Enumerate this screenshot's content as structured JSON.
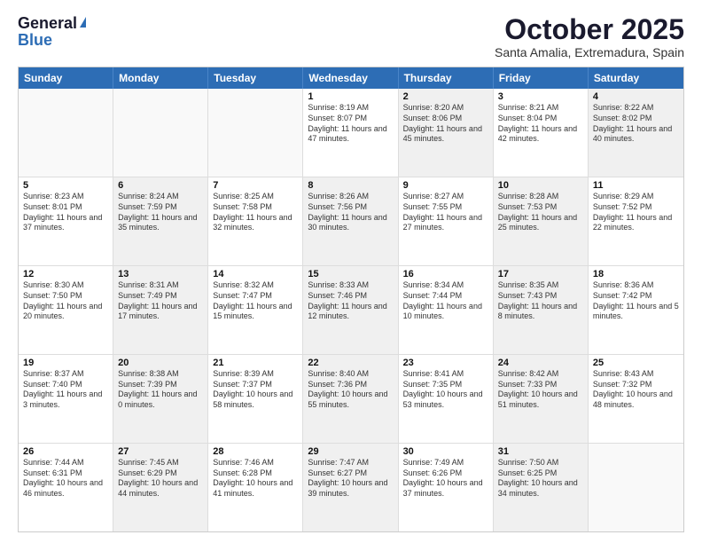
{
  "header": {
    "logo_general": "General",
    "logo_blue": "Blue",
    "month_title": "October 2025",
    "subtitle": "Santa Amalia, Extremadura, Spain"
  },
  "days_of_week": [
    "Sunday",
    "Monday",
    "Tuesday",
    "Wednesday",
    "Thursday",
    "Friday",
    "Saturday"
  ],
  "weeks": [
    {
      "cells": [
        {
          "day": "",
          "empty": true,
          "shaded": false
        },
        {
          "day": "",
          "empty": true,
          "shaded": false
        },
        {
          "day": "",
          "empty": true,
          "shaded": false
        },
        {
          "day": "1",
          "empty": false,
          "shaded": false,
          "text": "Sunrise: 8:19 AM\nSunset: 8:07 PM\nDaylight: 11 hours\nand 47 minutes."
        },
        {
          "day": "2",
          "empty": false,
          "shaded": true,
          "text": "Sunrise: 8:20 AM\nSunset: 8:06 PM\nDaylight: 11 hours\nand 45 minutes."
        },
        {
          "day": "3",
          "empty": false,
          "shaded": false,
          "text": "Sunrise: 8:21 AM\nSunset: 8:04 PM\nDaylight: 11 hours\nand 42 minutes."
        },
        {
          "day": "4",
          "empty": false,
          "shaded": true,
          "text": "Sunrise: 8:22 AM\nSunset: 8:02 PM\nDaylight: 11 hours\nand 40 minutes."
        }
      ]
    },
    {
      "cells": [
        {
          "day": "5",
          "empty": false,
          "shaded": false,
          "text": "Sunrise: 8:23 AM\nSunset: 8:01 PM\nDaylight: 11 hours\nand 37 minutes."
        },
        {
          "day": "6",
          "empty": false,
          "shaded": true,
          "text": "Sunrise: 8:24 AM\nSunset: 7:59 PM\nDaylight: 11 hours\nand 35 minutes."
        },
        {
          "day": "7",
          "empty": false,
          "shaded": false,
          "text": "Sunrise: 8:25 AM\nSunset: 7:58 PM\nDaylight: 11 hours\nand 32 minutes."
        },
        {
          "day": "8",
          "empty": false,
          "shaded": true,
          "text": "Sunrise: 8:26 AM\nSunset: 7:56 PM\nDaylight: 11 hours\nand 30 minutes."
        },
        {
          "day": "9",
          "empty": false,
          "shaded": false,
          "text": "Sunrise: 8:27 AM\nSunset: 7:55 PM\nDaylight: 11 hours\nand 27 minutes."
        },
        {
          "day": "10",
          "empty": false,
          "shaded": true,
          "text": "Sunrise: 8:28 AM\nSunset: 7:53 PM\nDaylight: 11 hours\nand 25 minutes."
        },
        {
          "day": "11",
          "empty": false,
          "shaded": false,
          "text": "Sunrise: 8:29 AM\nSunset: 7:52 PM\nDaylight: 11 hours\nand 22 minutes."
        }
      ]
    },
    {
      "cells": [
        {
          "day": "12",
          "empty": false,
          "shaded": false,
          "text": "Sunrise: 8:30 AM\nSunset: 7:50 PM\nDaylight: 11 hours\nand 20 minutes."
        },
        {
          "day": "13",
          "empty": false,
          "shaded": true,
          "text": "Sunrise: 8:31 AM\nSunset: 7:49 PM\nDaylight: 11 hours\nand 17 minutes."
        },
        {
          "day": "14",
          "empty": false,
          "shaded": false,
          "text": "Sunrise: 8:32 AM\nSunset: 7:47 PM\nDaylight: 11 hours\nand 15 minutes."
        },
        {
          "day": "15",
          "empty": false,
          "shaded": true,
          "text": "Sunrise: 8:33 AM\nSunset: 7:46 PM\nDaylight: 11 hours\nand 12 minutes."
        },
        {
          "day": "16",
          "empty": false,
          "shaded": false,
          "text": "Sunrise: 8:34 AM\nSunset: 7:44 PM\nDaylight: 11 hours\nand 10 minutes."
        },
        {
          "day": "17",
          "empty": false,
          "shaded": true,
          "text": "Sunrise: 8:35 AM\nSunset: 7:43 PM\nDaylight: 11 hours\nand 8 minutes."
        },
        {
          "day": "18",
          "empty": false,
          "shaded": false,
          "text": "Sunrise: 8:36 AM\nSunset: 7:42 PM\nDaylight: 11 hours\nand 5 minutes."
        }
      ]
    },
    {
      "cells": [
        {
          "day": "19",
          "empty": false,
          "shaded": false,
          "text": "Sunrise: 8:37 AM\nSunset: 7:40 PM\nDaylight: 11 hours\nand 3 minutes."
        },
        {
          "day": "20",
          "empty": false,
          "shaded": true,
          "text": "Sunrise: 8:38 AM\nSunset: 7:39 PM\nDaylight: 11 hours\nand 0 minutes."
        },
        {
          "day": "21",
          "empty": false,
          "shaded": false,
          "text": "Sunrise: 8:39 AM\nSunset: 7:37 PM\nDaylight: 10 hours\nand 58 minutes."
        },
        {
          "day": "22",
          "empty": false,
          "shaded": true,
          "text": "Sunrise: 8:40 AM\nSunset: 7:36 PM\nDaylight: 10 hours\nand 55 minutes."
        },
        {
          "day": "23",
          "empty": false,
          "shaded": false,
          "text": "Sunrise: 8:41 AM\nSunset: 7:35 PM\nDaylight: 10 hours\nand 53 minutes."
        },
        {
          "day": "24",
          "empty": false,
          "shaded": true,
          "text": "Sunrise: 8:42 AM\nSunset: 7:33 PM\nDaylight: 10 hours\nand 51 minutes."
        },
        {
          "day": "25",
          "empty": false,
          "shaded": false,
          "text": "Sunrise: 8:43 AM\nSunset: 7:32 PM\nDaylight: 10 hours\nand 48 minutes."
        }
      ]
    },
    {
      "cells": [
        {
          "day": "26",
          "empty": false,
          "shaded": false,
          "text": "Sunrise: 7:44 AM\nSunset: 6:31 PM\nDaylight: 10 hours\nand 46 minutes."
        },
        {
          "day": "27",
          "empty": false,
          "shaded": true,
          "text": "Sunrise: 7:45 AM\nSunset: 6:29 PM\nDaylight: 10 hours\nand 44 minutes."
        },
        {
          "day": "28",
          "empty": false,
          "shaded": false,
          "text": "Sunrise: 7:46 AM\nSunset: 6:28 PM\nDaylight: 10 hours\nand 41 minutes."
        },
        {
          "day": "29",
          "empty": false,
          "shaded": true,
          "text": "Sunrise: 7:47 AM\nSunset: 6:27 PM\nDaylight: 10 hours\nand 39 minutes."
        },
        {
          "day": "30",
          "empty": false,
          "shaded": false,
          "text": "Sunrise: 7:49 AM\nSunset: 6:26 PM\nDaylight: 10 hours\nand 37 minutes."
        },
        {
          "day": "31",
          "empty": false,
          "shaded": true,
          "text": "Sunrise: 7:50 AM\nSunset: 6:25 PM\nDaylight: 10 hours\nand 34 minutes."
        },
        {
          "day": "",
          "empty": true,
          "shaded": false,
          "text": ""
        }
      ]
    }
  ]
}
